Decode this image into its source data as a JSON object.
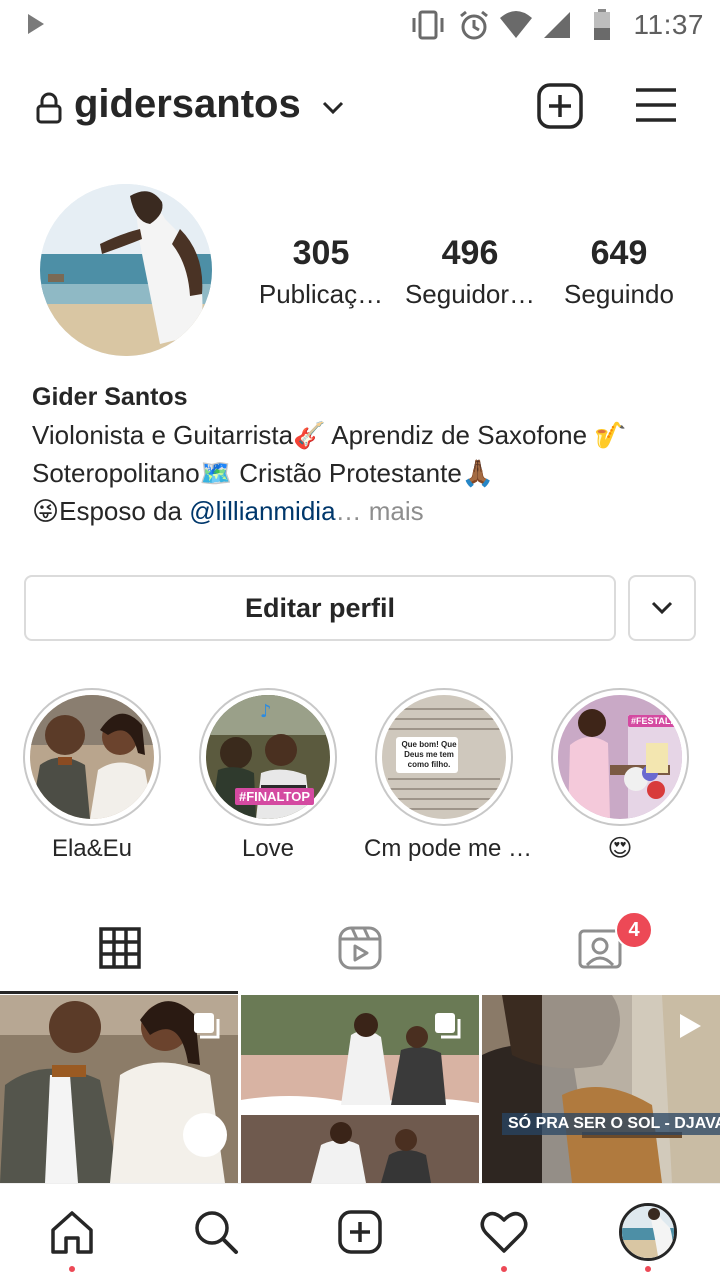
{
  "status_bar": {
    "time": "11:37"
  },
  "header": {
    "username": "gidersantos"
  },
  "profile": {
    "stats": [
      {
        "count": "305",
        "label": "Publicaç…"
      },
      {
        "count": "496",
        "label": "Seguidor…"
      },
      {
        "count": "649",
        "label": "Seguindo"
      }
    ],
    "name": "Gider Santos",
    "bio_line1": "Violonista e Guitarrista🎸 Aprendiz de Saxofone 🎷",
    "bio_line2": "Soteropolitano🗺️ Cristão Protestante🙏🏾",
    "bio_line3_prefix": "😜Esposo da ",
    "bio_mention": "@lillianmidia",
    "bio_more": "… mais"
  },
  "edit_profile_label": "Editar perfil",
  "highlights": [
    {
      "label": "Ela&Eu"
    },
    {
      "label": "Love",
      "sticker": "#FINALTOP"
    },
    {
      "label": "Cm pode me …",
      "quote": "Que bom! Que Deus me tem como filho."
    },
    {
      "label": "😍",
      "sticker": "#FESTALINDA"
    }
  ],
  "tabs": {
    "tagged_badge": "4"
  },
  "posts": [
    {
      "kind": "carousel"
    },
    {
      "kind": "carousel"
    },
    {
      "kind": "video",
      "caption": "SÓ PRA SER O SOL - DJAVAN"
    }
  ]
}
